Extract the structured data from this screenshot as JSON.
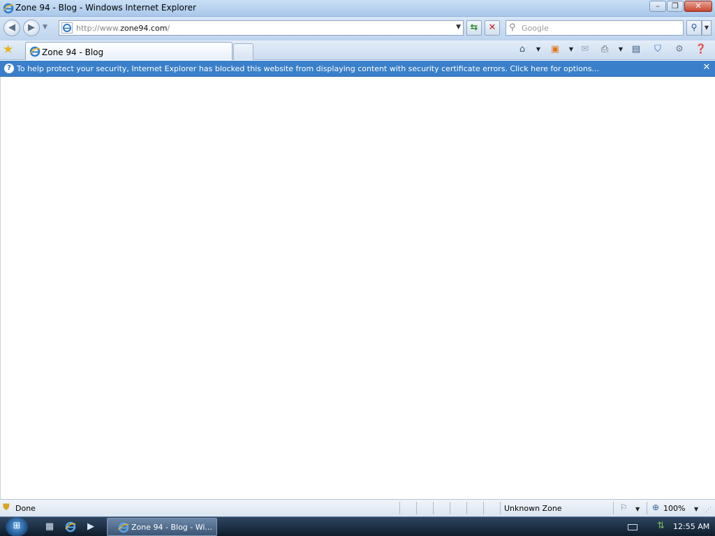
{
  "window": {
    "title": "Zone 94 - Blog - Windows Internet Explorer",
    "minimize_glyph": "–",
    "maximize_glyph": "❐",
    "close_glyph": "✕"
  },
  "navigation": {
    "address_prefix": "http://www.",
    "address_domain": "zone94.com",
    "address_suffix": "/",
    "search_placeholder": "Google"
  },
  "tabs": [
    {
      "label": "Zone 94 - Blog",
      "active": true
    }
  ],
  "command_bar": {
    "icons": [
      "home-icon",
      "feeds-icon",
      "read-mail-icon",
      "print-icon",
      "page-icon",
      "safety-icon",
      "tools-icon",
      "help-icon"
    ]
  },
  "info_bar": {
    "message": "To help protect your security, Internet Explorer has blocked this website from displaying content with security certificate errors. Click here for options..."
  },
  "status_bar": {
    "status": "Done",
    "zone": "Unknown Zone",
    "zoom": "100%"
  },
  "taskbar": {
    "task_label": "Zone 94 - Blog - Wi...",
    "clock": "12:55 AM"
  },
  "colors": {
    "info_bar": "#3a7fc9",
    "title_bar": "#b9d4f0",
    "taskbar": "#1f3347"
  }
}
